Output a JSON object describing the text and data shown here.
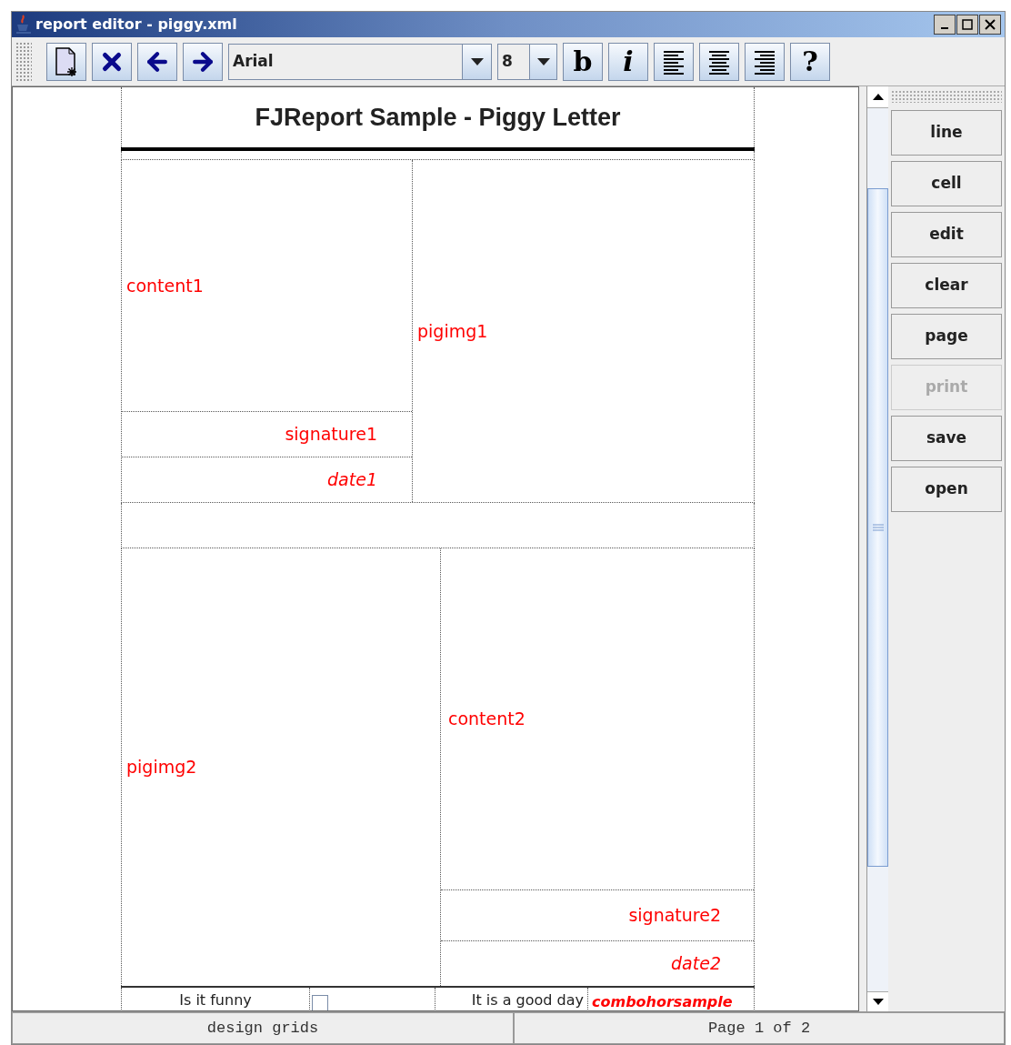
{
  "window": {
    "title": "report editor - piggy.xml"
  },
  "toolbar": {
    "buttons": [
      {
        "kind": "new"
      },
      {
        "kind": "delete"
      },
      {
        "kind": "back"
      },
      {
        "kind": "forward"
      }
    ],
    "font": {
      "value": "Arial"
    },
    "size": {
      "value": "8"
    },
    "format_buttons": [
      {
        "kind": "text",
        "label": "b",
        "italic": false
      },
      {
        "kind": "text",
        "label": "i",
        "italic": true
      },
      {
        "kind": "align-left"
      },
      {
        "kind": "align-center"
      },
      {
        "kind": "align-right"
      },
      {
        "kind": "text",
        "label": "?",
        "italic": false
      }
    ]
  },
  "report": {
    "title": "FJReport Sample - Piggy Letter",
    "content1": "content1",
    "signature1": "signature1",
    "date1": "date1",
    "pigimg1": "pigimg1",
    "pigimg2": "pigimg2",
    "content2": "content2",
    "signature2": "signature2",
    "date2": "date2",
    "bottom_row": {
      "label1": "Is it funny",
      "checked": false,
      "label2": "It is a good day",
      "combo": "combohorsample"
    }
  },
  "side_buttons": [
    {
      "label": "line",
      "disabled": false
    },
    {
      "label": "cell",
      "disabled": false
    },
    {
      "label": "edit",
      "disabled": false
    },
    {
      "label": "clear",
      "disabled": false
    },
    {
      "label": "page",
      "disabled": false
    },
    {
      "label": "print",
      "disabled": true
    },
    {
      "label": "save",
      "disabled": false
    },
    {
      "label": "open",
      "disabled": false
    }
  ],
  "status_bar": [
    "design grids",
    "Page 1 of 2"
  ]
}
